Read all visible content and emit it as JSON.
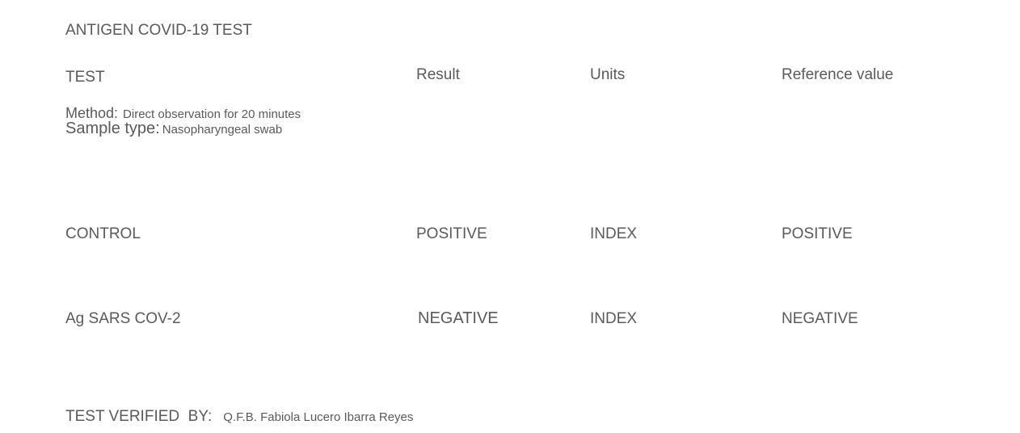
{
  "document": {
    "title": "ANTIGEN COVID-19 TEST",
    "columns": {
      "test": "TEST",
      "result": "Result",
      "units": "Units",
      "reference": "Reference value"
    },
    "method": {
      "label": "Method:",
      "value": "Direct observation for 20 minutes"
    },
    "sample_type": {
      "label": "Sample type:",
      "value": "Nasopharyngeal swab"
    },
    "rows": [
      {
        "test": "CONTROL",
        "result": "POSITIVE",
        "units": "INDEX",
        "reference": "POSITIVE"
      },
      {
        "test": "Ag SARS COV-2",
        "result": "NEGATIVE",
        "units": "INDEX",
        "reference": "NEGATIVE"
      }
    ],
    "verified": {
      "label": "TEST VERIFIED  BY:",
      "name": "Q.F.B. Fabiola Lucero Ibarra Reyes"
    }
  }
}
